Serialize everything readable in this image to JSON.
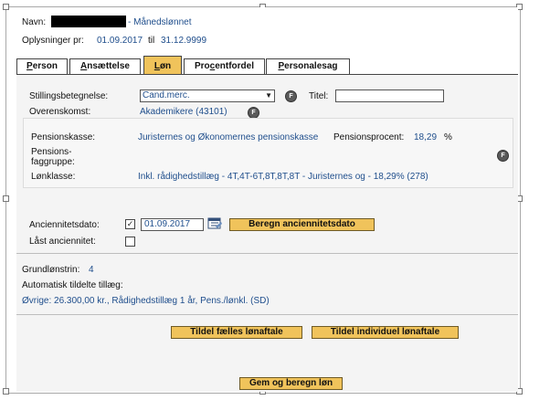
{
  "header": {
    "navn_label": "Navn:",
    "navn_suffix": "- Månedslønnet",
    "oplysninger_label": "Oplysninger pr:",
    "period_from": "01.09.2017",
    "period_sep": "til",
    "period_to": "31.12.9999"
  },
  "tabs": [
    {
      "label": "Person",
      "accesskey": "P"
    },
    {
      "label": "Ansættelse",
      "accesskey": "A"
    },
    {
      "label": "Løn",
      "accesskey": "L"
    },
    {
      "label": "Procentfordel",
      "accesskey": "c"
    },
    {
      "label": "Personalesag",
      "accesskey": "P"
    }
  ],
  "stilling": {
    "label": "Stillingsbetegnelse:",
    "value": "Cand.merc.",
    "titel_label": "Titel:",
    "titel_value": ""
  },
  "overenskomst": {
    "label": "Overenskomst:",
    "value": "Akademikere (43101)"
  },
  "pension": {
    "kasse_label": "Pensionskasse:",
    "kasse_value": "Juristernes og Økonomernes pensionskasse",
    "procent_label": "Pensionsprocent:",
    "procent_value": "18,29",
    "procent_unit": "%",
    "fag_label_line1": "Pensions-",
    "fag_label_line2": "faggruppe:",
    "lonklasse_label": "Lønklasse:",
    "lonklasse_value": "Inkl. rådighedstillæg - 4T,4T-6T,8T,8T,8T - Juristernes og - 18,29% (278)"
  },
  "anciennitet": {
    "label": "Anciennitetsdato:",
    "checked": true,
    "date_value": "01.09.2017",
    "beregn_button": "Beregn anciennitetsdato",
    "laast_label": "Låst anciennitet:"
  },
  "grundlon": {
    "label": "Grundlønstrin:",
    "value": "4"
  },
  "tillaeg": {
    "label": "Automatisk tildelte tillæg:",
    "value": "Øvrige: 26.300,00 kr., Rådighedstillæg 1 år, Pens./lønkl. (SD)"
  },
  "buttons": {
    "faelles": "Tildel fælles lønaftale",
    "individuel": "Tildel individuel lønaftale",
    "gem": "Gem og beregn løn"
  },
  "icons": {
    "f_button": "F"
  },
  "colors": {
    "accent": "#f0c35b",
    "link_text": "#1f4e8c",
    "redacted": "#000000"
  }
}
